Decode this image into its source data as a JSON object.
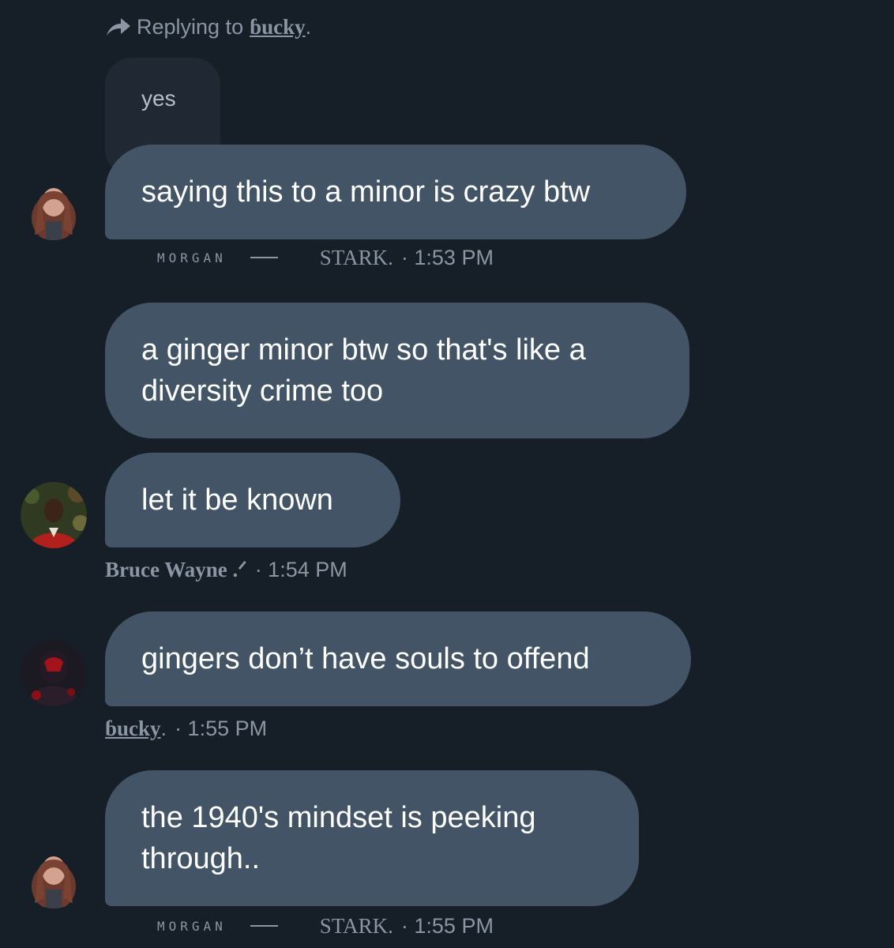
{
  "reply": {
    "prefix": "Replying to",
    "handle": "ɓucky",
    "suffix": "."
  },
  "quoted_message": {
    "text": "yes"
  },
  "messages": [
    {
      "text": "saying this to a minor is crazy btw"
    },
    {
      "text": "a ginger minor btw so that's like a diversity crime too"
    },
    {
      "text": "let it be known"
    },
    {
      "text": "gingers don’t have souls to offend"
    },
    {
      "text": "the 1940's mindset is peeking through.."
    }
  ],
  "meta": {
    "morgan_1": {
      "name_a": "MORGAN",
      "name_b": "STARK.",
      "time": "· 1:53 PM"
    },
    "bruce": {
      "name": "Bruce Wayne .ᐟ",
      "time": "· 1:54 PM"
    },
    "bucky": {
      "name": "ɓucky",
      "suffix": ".",
      "time": "· 1:55 PM"
    },
    "morgan_2": {
      "name_a": "MORGAN",
      "name_b": "STARK.",
      "time": "· 1:55 PM"
    }
  },
  "colors": {
    "background": "#161e28",
    "bubble": "#425465",
    "quoted_bubble": "#1f2833",
    "meta_text": "#8a96a3"
  },
  "icons": {
    "reply": "reply-arrow-icon"
  }
}
